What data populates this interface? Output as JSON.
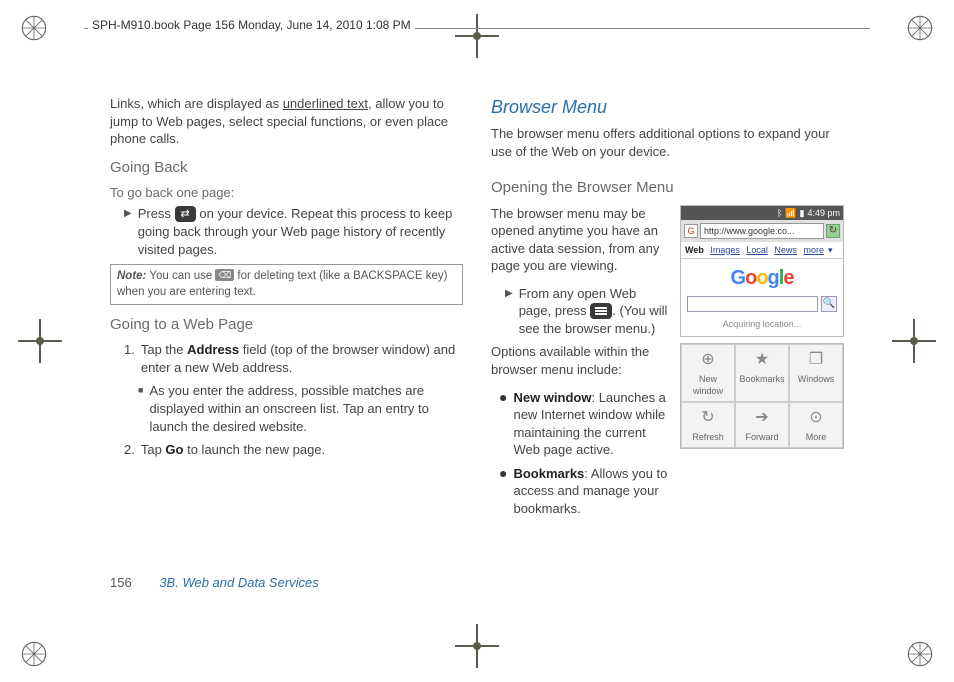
{
  "header": {
    "running_head": "SPH-M910.book  Page 156  Monday, June 14, 2010  1:08 PM"
  },
  "left": {
    "intro": {
      "pre": "Links, which are displayed as ",
      "underlined": "underlined text",
      "post": ", allow you to jump to Web pages, select special functions, or even place phone calls."
    },
    "going_back": {
      "heading": "Going Back",
      "sub": "To go back one page:",
      "step_pre": "Press ",
      "step_post": " on your device. Repeat this process to keep going back through your Web page history of recently visited pages."
    },
    "note": {
      "label": "Note:",
      "pre": "  You can use ",
      "post": " for deleting text (like a BACKSPACE key) when you are entering text."
    },
    "going_to": {
      "heading": "Going to a Web Page",
      "step1_pre": "Tap the ",
      "step1_bold": "Address",
      "step1_post": " field (top of the browser window) and enter a new Web address.",
      "sub1": "As you enter the address, possible matches are displayed within an onscreen list. Tap an entry to launch the desired website.",
      "step2_pre": "Tap ",
      "step2_bold": "Go",
      "step2_post": " to launch the new page."
    }
  },
  "right": {
    "heading": "Browser Menu",
    "intro": "The browser menu offers additional options to expand your use of the Web on your device.",
    "opening": {
      "heading": "Opening the Browser Menu",
      "p1": "The browser menu may be opened anytime you have an active data session, from any page you are viewing.",
      "step_pre": "From any open Web page, press ",
      "step_post": ". (You will see the browser menu.)",
      "p2": "Options available within the browser menu include:",
      "b1_bold": "New window",
      "b1_rest": ": Launches a new Internet window while maintaining the current Web page active.",
      "b2_bold": "Bookmarks",
      "b2_rest": ": Allows you to access and manage your bookmarks."
    }
  },
  "phone": {
    "time": "4:49 pm",
    "url": "http://www.google.co...",
    "tabs": {
      "web": "Web",
      "images": "Images",
      "local": "Local",
      "news": "News",
      "more": "more"
    },
    "logo": [
      "G",
      "o",
      "o",
      "g",
      "l",
      "e"
    ],
    "acquiring": "Acquiring location..."
  },
  "menu": {
    "items": [
      {
        "icon": "⊕",
        "label": "New window"
      },
      {
        "icon": "★",
        "label": "Bookmarks"
      },
      {
        "icon": "❐",
        "label": "Windows"
      },
      {
        "icon": "↻",
        "label": "Refresh"
      },
      {
        "icon": "➔",
        "label": "Forward"
      },
      {
        "icon": "⊙",
        "label": "More"
      }
    ]
  },
  "footer": {
    "page": "156",
    "section": "3B. Web and Data Services"
  }
}
